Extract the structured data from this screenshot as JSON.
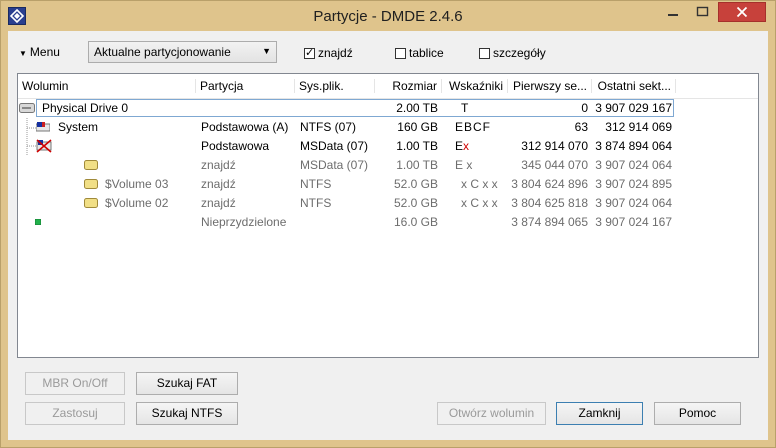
{
  "window": {
    "title": "Partycje - DMDE 2.4.6"
  },
  "toolbar": {
    "menu_label": "Menu",
    "view_select": "Aktualne partycjonowanie",
    "chk_find": {
      "label": "znajdź",
      "checked": true
    },
    "chk_tables": {
      "label": "tablice",
      "checked": false
    },
    "chk_details": {
      "label": "szczegóły",
      "checked": false
    }
  },
  "columns": [
    "Wolumin",
    "Partycja",
    "Sys.plik.",
    "Rozmiar",
    "Wskaźniki",
    "Pierwszy se...",
    "Ostatni sekt..."
  ],
  "rows": [
    {
      "volume": "Physical Drive 0",
      "partition": "",
      "fs": "",
      "size": "2.00 TB",
      "flags": "T",
      "first": "0",
      "last": "3 907 029 167"
    },
    {
      "volume": "System",
      "partition": "Podstawowa (A)",
      "fs": "NTFS (07)",
      "size": "160 GB",
      "flags": "EBCF",
      "first": "63",
      "last": "312 914 069"
    },
    {
      "volume": "",
      "partition": "Podstawowa",
      "fs": "MSData (07)",
      "size": "1.00 TB",
      "flags": "E",
      "flags_extra": "x",
      "first": "312 914 070",
      "last": "3 874 894 064"
    },
    {
      "volume": "",
      "partition": "znajdź",
      "fs": "MSData (07)",
      "size": "1.00 TB",
      "flags": "E x",
      "first": "345 044 070",
      "last": "3 907 024 064"
    },
    {
      "volume": "$Volume 03",
      "partition": "znajdź",
      "fs": "NTFS",
      "size": "52.0 GB",
      "flags": "x C x x",
      "first": "3 804 624 896",
      "last": "3 907 024 895"
    },
    {
      "volume": "$Volume 02",
      "partition": "znajdź",
      "fs": "NTFS",
      "size": "52.0 GB",
      "flags": "x C x x",
      "first": "3 804 625 818",
      "last": "3 907 024 064"
    },
    {
      "volume": "",
      "partition": "Nieprzydzielone",
      "fs": "",
      "size": "16.0 GB",
      "flags": "",
      "first": "3 874 894 065",
      "last": "3 907 024 167"
    }
  ],
  "buttons": {
    "mbr": "MBR On/Off",
    "fat": "Szukaj FAT",
    "apply": "Zastosuj",
    "ntfs": "Szukaj NTFS",
    "open": "Otwórz wolumin",
    "close": "Zamknij",
    "help": "Pomoc"
  },
  "colors": {
    "titlebar": "#dfc48c",
    "close_btn": "#c7413b",
    "selection": "#7fa8d2",
    "red_flag": "#d00000"
  }
}
